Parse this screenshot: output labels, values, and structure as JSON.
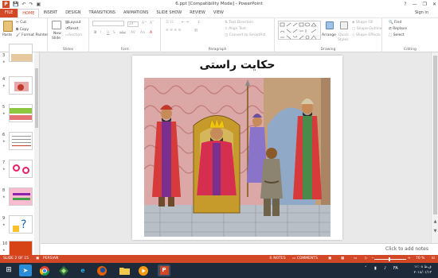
{
  "window": {
    "title": "6.ppt [Compatibility Mode] - PowerPoint",
    "qat": [
      "save-icon",
      "undo-icon",
      "redo-icon",
      "slideshow-icon"
    ],
    "controls": [
      "?",
      "—",
      "❐",
      "✕"
    ]
  },
  "tabs": [
    "FILE",
    "HOME",
    "INSERT",
    "DESIGN",
    "TRANSITIONS",
    "ANIMATIONS",
    "SLIDE SHOW",
    "REVIEW",
    "VIEW"
  ],
  "active_tab": "HOME",
  "sign_in": "Sign in",
  "ribbon": {
    "clipboard": {
      "label": "Clipboard",
      "paste": "Paste",
      "cut": "Cut",
      "copy": "Copy",
      "format_painter": "Format Painter"
    },
    "slides": {
      "label": "Slides",
      "new_slide": "New",
      "new_slide2": "Slide",
      "layout": "Layout",
      "reset": "Reset",
      "section": "Section"
    },
    "font": {
      "label": "Font",
      "size": "24",
      "buttons": [
        "B",
        "I",
        "U",
        "S",
        "abc",
        "AV",
        "Aa"
      ]
    },
    "paragraph": {
      "label": "Paragraph",
      "text_direction": "Text Direction",
      "align_text": "Align Text",
      "smartart": "Convert to SmartArt"
    },
    "drawing": {
      "label": "Drawing",
      "arrange": "Arrange",
      "quick_styles": "Quick",
      "quick_styles2": "Styles",
      "shape_fill": "Shape Fill",
      "shape_outline": "Shape Outline",
      "shape_effects": "Shape Effects"
    },
    "editing": {
      "label": "Editing",
      "find": "Find",
      "replace": "Replace",
      "select": "Select"
    }
  },
  "thumbnails": [
    {
      "num": "3",
      "star": "★"
    },
    {
      "num": "4",
      "star": "★"
    },
    {
      "num": "5",
      "star": "★"
    },
    {
      "num": "6",
      "star": "★"
    },
    {
      "num": "7",
      "star": "★"
    },
    {
      "num": "8",
      "star": "★"
    },
    {
      "num": "9",
      "star": "★"
    },
    {
      "num": "10",
      "star": "★"
    }
  ],
  "slide": {
    "title": "حكايت راستی"
  },
  "notes": {
    "placeholder": "Click to add notes"
  },
  "status": {
    "slide_of": "SLIDE 2 OF 15",
    "language": "PERSIAN",
    "notes": "NOTES",
    "comments": "COMMENTS",
    "zoom": "70 %"
  },
  "taskbar": {
    "lang": "FA",
    "time": "۱۱:۰۸ ق.ظ",
    "date": "۲۰۱۸/۰۱/۱۳"
  },
  "colors": {
    "accent": "#d24726",
    "taskbar": "#1c2a3a"
  }
}
